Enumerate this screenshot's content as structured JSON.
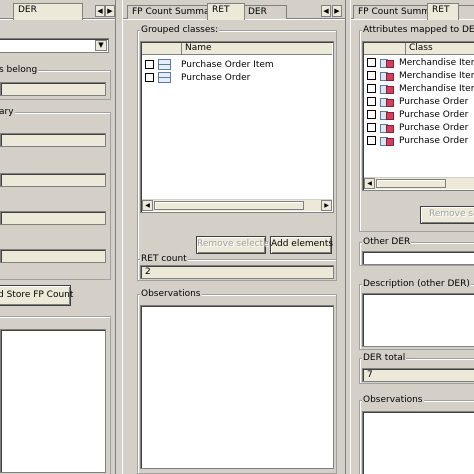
{
  "left_panel": {
    "tabs": [
      "DER"
    ],
    "scroll_left": "◀",
    "scroll_right": "▶",
    "belong_label": "s belong",
    "summary_label": "ary",
    "store_button": "d Store FP Count"
  },
  "middle_panel": {
    "tabs": [
      "FP Count Summary",
      "RET",
      "DER"
    ],
    "scroll_left": "◀",
    "scroll_right": "▶",
    "grouped_label": "Grouped classes:",
    "column_name": "Name",
    "rows": [
      "Purchase Order Item",
      "Purchase Order"
    ],
    "remove_button": "Remove selected",
    "add_button": "Add elements",
    "ret_count_label": "RET count",
    "ret_count_value": "2",
    "observations_label": "Observations"
  },
  "right_panel": {
    "tabs": [
      "FP Count Summary",
      "RET"
    ],
    "attributes_label": "Attributes mapped to DERs:",
    "column_class": "Class",
    "rows": [
      "Merchandise Item",
      "Merchandise Item",
      "Merchandise Item",
      "Purchase Order",
      "Purchase Order",
      "Purchase Order",
      "Purchase Order"
    ],
    "remove_button": "Remove sele",
    "other_der_label": "Other DER",
    "description_label": "Description (other DER)",
    "der_total_label": "DER total",
    "der_total_value": "7",
    "observations_label": "Observations"
  }
}
